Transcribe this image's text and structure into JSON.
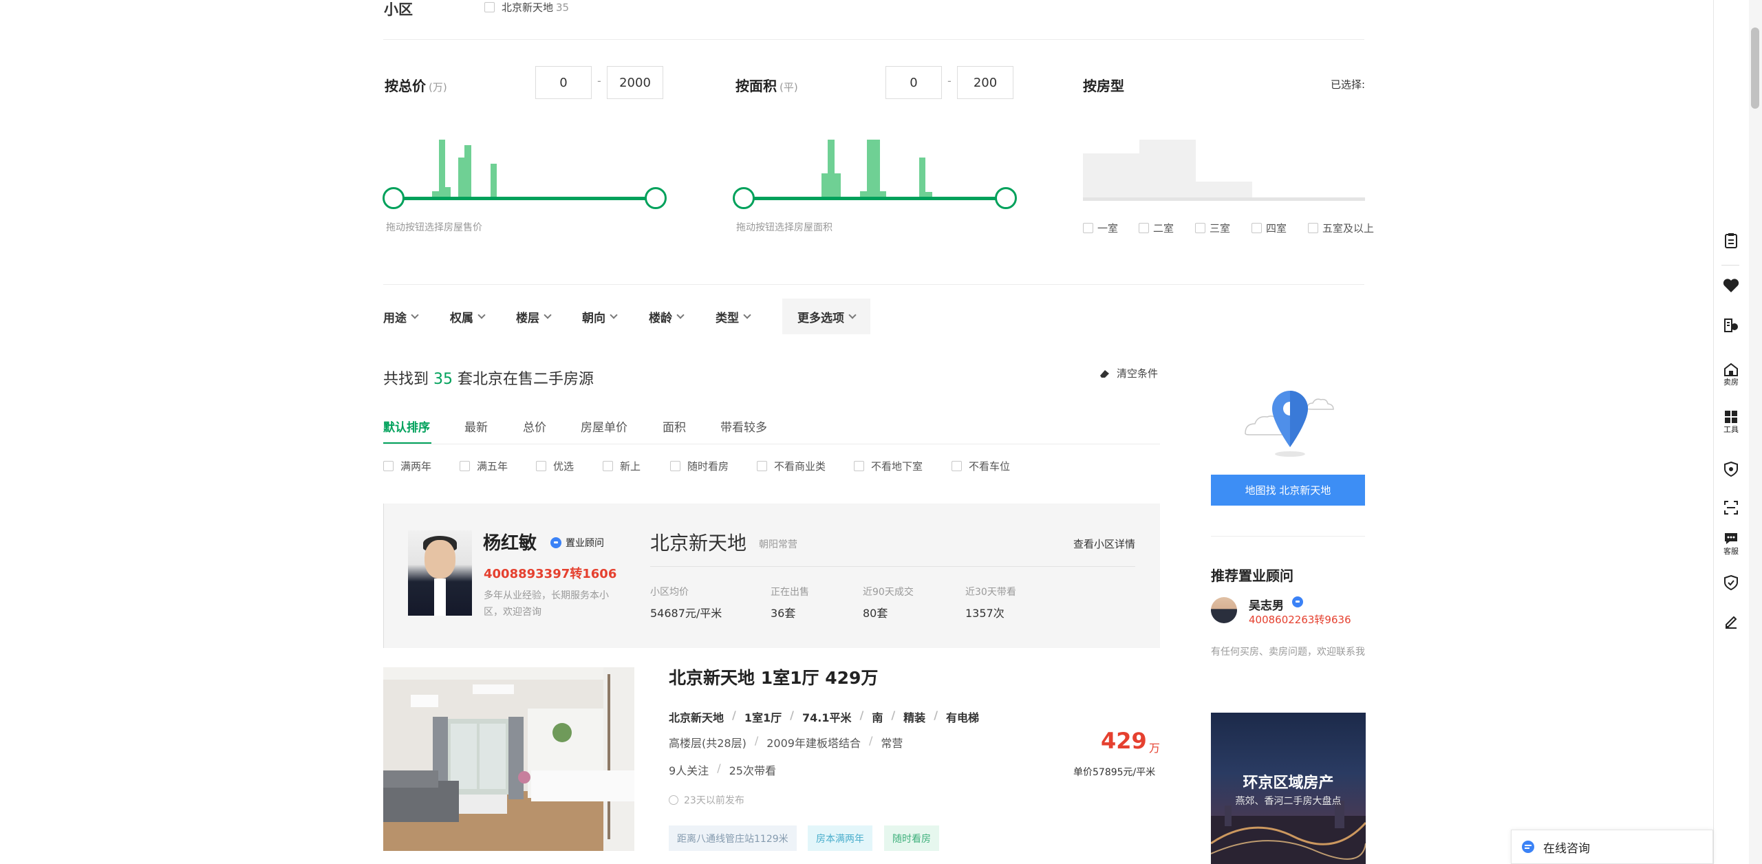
{
  "community_section": {
    "label": "小区",
    "option_label": "北京新天地",
    "option_count": "35"
  },
  "price_filter": {
    "title": "按总价",
    "unit": "(万)",
    "min": "0",
    "max": "2000",
    "dash": "-",
    "hint": "拖动按钮选择房屋售价"
  },
  "area_filter": {
    "title": "按面积",
    "unit": "(平)",
    "min": "0",
    "max": "200",
    "dash": "-",
    "hint": "拖动按钮选择房屋面积"
  },
  "room_filter": {
    "title": "按房型",
    "selected_label": "已选择:",
    "options": [
      "一室",
      "二室",
      "三室",
      "四室",
      "五室及以上"
    ]
  },
  "more_filters": {
    "items": [
      "用途",
      "权属",
      "楼层",
      "朝向",
      "楼龄",
      "类型"
    ],
    "more_label": "更多选项"
  },
  "results": {
    "prefix": "共找到",
    "count": "35",
    "suffix": "套北京在售二手房源",
    "clear_label": "清空条件"
  },
  "sort_tabs": [
    "默认排序",
    "最新",
    "总价",
    "房屋单价",
    "面积",
    "带看较多"
  ],
  "tag_filters": [
    "满两年",
    "满五年",
    "优选",
    "新上",
    "随时看房",
    "不看商业类",
    "不看地下室",
    "不看车位"
  ],
  "agent": {
    "name": "杨红敏",
    "badge": "置业顾问",
    "phone": "4008893397转1606",
    "desc": "多年从业经验，长期服务本小区，欢迎咨询"
  },
  "community": {
    "name": "北京新天地",
    "district": "朝阳常营",
    "detail_link": "查看小区详情",
    "stats": [
      {
        "label": "小区均价",
        "value": "54687元/平米"
      },
      {
        "label": "正在出售",
        "value": "36套"
      },
      {
        "label": "近90天成交",
        "value": "80套"
      },
      {
        "label": "近30天带看",
        "value": "1357次"
      }
    ]
  },
  "listing": {
    "title": "北京新天地 1室1厅 429万",
    "info1": [
      "北京新天地",
      "1室1厅",
      "74.1平米",
      "南",
      "精装",
      "有电梯"
    ],
    "info2": [
      "高楼层(共28层)",
      "2009年建板塔结合",
      "常营"
    ],
    "info3": [
      "9人关注",
      "25次带看"
    ],
    "published": "23天以前发布",
    "price": "429",
    "price_unit": "万",
    "unit_price": "单价57895元/平米",
    "tags": [
      {
        "text": "距离八通线管庄站1129米",
        "bg": "#eef3f8",
        "color": "#849aae"
      },
      {
        "text": "房本满两年",
        "bg": "#e3f6fa",
        "color": "#4aaecc"
      },
      {
        "text": "随时看房",
        "bg": "#e6f7ee",
        "color": "#3fb07c"
      }
    ]
  },
  "sidebar": {
    "map_button": "地图找 北京新天地",
    "recommend_title": "推荐置业顾问",
    "advisor_name": "吴志男",
    "advisor_phone": "4008602263转9636",
    "advisor_desc": "有任何买房、卖房问题，欢迎联系我",
    "ad_title": "环京区域房产",
    "ad_sub": "燕郊、香河二手房大盘点"
  },
  "toolbar": {
    "sell_label": "卖房",
    "tools_label": "工具",
    "service_label": "客服",
    "consult_label": "在线咨询"
  },
  "colors": {
    "accent_green": "#00a15b",
    "price_red": "#e5402f",
    "map_blue": "#3d8ef5"
  }
}
